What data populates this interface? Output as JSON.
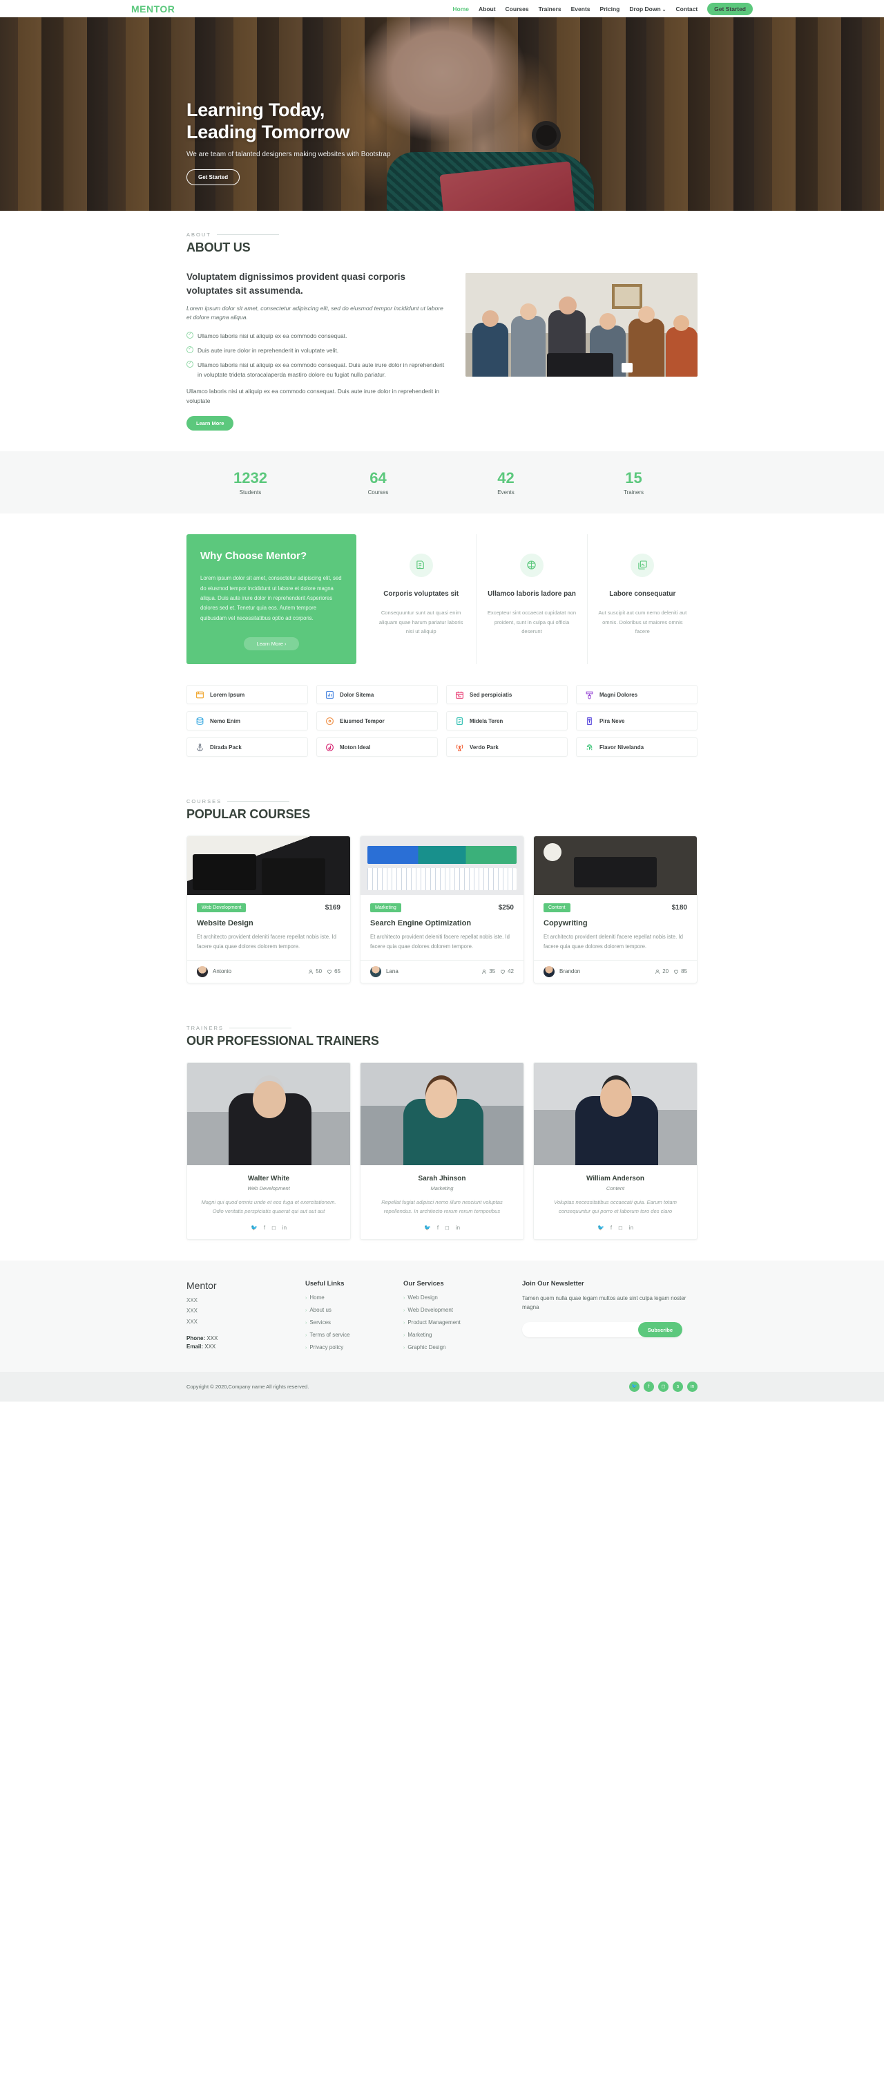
{
  "header": {
    "logo": "MENTOR",
    "nav": [
      {
        "label": "Home",
        "active": true
      },
      {
        "label": "About",
        "active": false
      },
      {
        "label": "Courses",
        "active": false
      },
      {
        "label": "Trainers",
        "active": false
      },
      {
        "label": "Events",
        "active": false
      },
      {
        "label": "Pricing",
        "active": false
      },
      {
        "label": "Drop Down",
        "active": false,
        "caret": "⌄"
      },
      {
        "label": "Contact",
        "active": false
      }
    ],
    "cta": "Get Started"
  },
  "hero": {
    "title_line1": "Learning Today,",
    "title_line2": "Leading Tomorrow",
    "subtitle": "We are team of talanted designers making websites with Bootstrap",
    "button": "Get Started"
  },
  "about": {
    "eyebrow": "About",
    "title": "ABOUT US",
    "heading": "Voluptatem dignissimos provident quasi corporis voluptates sit assumenda.",
    "lead": "Lorem ipsum dolor sit amet, consectetur adipiscing elit, sed do eiusmod tempor incididunt ut labore et dolore magna aliqua.",
    "checks": [
      "Ullamco laboris nisi ut aliquip ex ea commodo consequat.",
      "Duis aute irure dolor in reprehenderit in voluptate velit.",
      "Ullamco laboris nisi ut aliquip ex ea commodo consequat. Duis aute irure dolor in reprehenderit in voluptate trideta storacalaperda mastiro dolore eu fugiat nulla pariatur."
    ],
    "tail": "Ullamco laboris nisi ut aliquip ex ea commodo consequat. Duis aute irure dolor in reprehenderit in voluptate",
    "button": "Learn More"
  },
  "counts": [
    {
      "num": "1232",
      "label": "Students"
    },
    {
      "num": "64",
      "label": "Courses"
    },
    {
      "num": "42",
      "label": "Events"
    },
    {
      "num": "15",
      "label": "Trainers"
    }
  ],
  "why": {
    "title": "Why Choose Mentor?",
    "body": "Lorem ipsum dolor sit amet, consectetur adipiscing elit, sed do eiusmod tempor incididunt ut labore et dolore magna aliqua. Duis aute irure dolor in reprehenderit Asperiores dolores sed et. Tenetur quia eos. Autem tempore quibusdam vel necessitatibus optio ad corporis.",
    "button": "Learn More  ›",
    "features": [
      {
        "icon": "document-icon",
        "title": "Corporis voluptates sit",
        "text": "Consequuntur sunt aut quasi enim aliquam quae harum pariatur laboris nisi ut aliquip"
      },
      {
        "icon": "cube-icon",
        "title": "Ullamco laboris ladore pan",
        "text": "Excepteur sint occaecat cupidatat non proident, sunt in culpa qui officia deserunt"
      },
      {
        "icon": "image-icon",
        "title": "Labore consequatur",
        "text": "Aut suscipit aut cum nemo deleniti aut omnis. Doloribus ut maiores omnis facere"
      }
    ]
  },
  "services": [
    {
      "label": "Lorem Ipsum",
      "icon": "window-icon",
      "color": "#f0a429"
    },
    {
      "label": "Dolor Sitema",
      "icon": "bar-chart-icon",
      "color": "#3c7ddd"
    },
    {
      "label": "Sed perspiciatis",
      "icon": "calendar-icon",
      "color": "#e8366f"
    },
    {
      "label": "Magni Dolores",
      "icon": "brush-icon",
      "color": "#9b4fd6"
    },
    {
      "label": "Nemo Enim",
      "icon": "database-icon",
      "color": "#35a7e0"
    },
    {
      "label": "Eiusmod Tempor",
      "icon": "target-icon",
      "color": "#ef8f45"
    },
    {
      "label": "Midela Teren",
      "icon": "notebook-icon",
      "color": "#16b7a8"
    },
    {
      "label": "Pira Neve",
      "icon": "tag-icon",
      "color": "#4734d8"
    },
    {
      "label": "Dirada Pack",
      "icon": "anchor-icon",
      "color": "#6f7886"
    },
    {
      "label": "Moton Ideal",
      "icon": "music-note-icon",
      "color": "#d41f6e"
    },
    {
      "label": "Verdo Park",
      "icon": "broadcast-icon",
      "color": "#f0562a"
    },
    {
      "label": "Flavor Nivelanda",
      "icon": "fingerprint-icon",
      "color": "#2fbf6e"
    }
  ],
  "courses": {
    "eyebrow": "Courses",
    "title": "POPULAR COURSES",
    "items": [
      {
        "badge": "Web Development",
        "price": "$169",
        "title": "Website Design",
        "text": "Et architecto provident deleniti facere repellat nobis iste. Id facere quia quae dolores dolorem tempore.",
        "author": "Antonio",
        "students": "50",
        "likes": "65"
      },
      {
        "badge": "Marketing",
        "price": "$250",
        "title": "Search Engine Optimization",
        "text": "Et architecto provident deleniti facere repellat nobis iste. Id facere quia quae dolores dolorem tempore.",
        "author": "Lana",
        "students": "35",
        "likes": "42"
      },
      {
        "badge": "Content",
        "price": "$180",
        "title": "Copywriting",
        "text": "Et architecto provident deleniti facere repellat nobis iste. Id facere quia quae dolores dolorem tempore.",
        "author": "Brandon",
        "students": "20",
        "likes": "85"
      }
    ]
  },
  "trainers": {
    "eyebrow": "Trainers",
    "title": "OUR PROFESSIONAL TRAINERS",
    "items": [
      {
        "name": "Walter White",
        "role": "Web Development",
        "text": "Magni qui quod omnis unde et eos fuga et exercitationem. Odio veritatis perspiciatis quaerat qui aut aut aut"
      },
      {
        "name": "Sarah Jhinson",
        "role": "Marketing",
        "text": "Repellat fugiat adipisci nemo illum nesciunt voluptas repellendus. In architecto rerum rerum temporibus"
      },
      {
        "name": "William Anderson",
        "role": "Content",
        "text": "Voluptas necessitatibus occaecati quia. Earum totam consequuntur qui porro et laborum toro des claro"
      }
    ],
    "socials": [
      "twitter-icon",
      "facebook-icon",
      "instagram-icon",
      "linkedin-icon"
    ]
  },
  "footer": {
    "brand": "Mentor",
    "address_lines": [
      "XXX",
      "XXX",
      "XXX"
    ],
    "phone_label": "Phone:",
    "phone_value": "XXX",
    "email_label": "Email:",
    "email_value": "XXX",
    "useful_links_title": "Useful Links",
    "useful_links": [
      "Home",
      "About us",
      "Services",
      "Terms of service",
      "Privacy policy"
    ],
    "services_title": "Our Services",
    "services": [
      "Web Design",
      "Web Development",
      "Product Management",
      "Marketing",
      "Graphic Design"
    ],
    "newsletter_title": "Join Our Newsletter",
    "newsletter_text": "Tamen quem nulla quae legam multos aute sint culpa legam noster magna",
    "newsletter_placeholder": "",
    "newsletter_value": "",
    "subscribe": "Subscribe",
    "copyright": "Copyright © 2020,Company name All rights reserved.",
    "socials": [
      "twitter-icon",
      "facebook-icon",
      "instagram-icon",
      "skype-icon",
      "linkedin-icon"
    ]
  },
  "colors": {
    "brand_green": "#5cc87d",
    "dark_text": "#37423b",
    "muted_text": "#8b9592"
  }
}
